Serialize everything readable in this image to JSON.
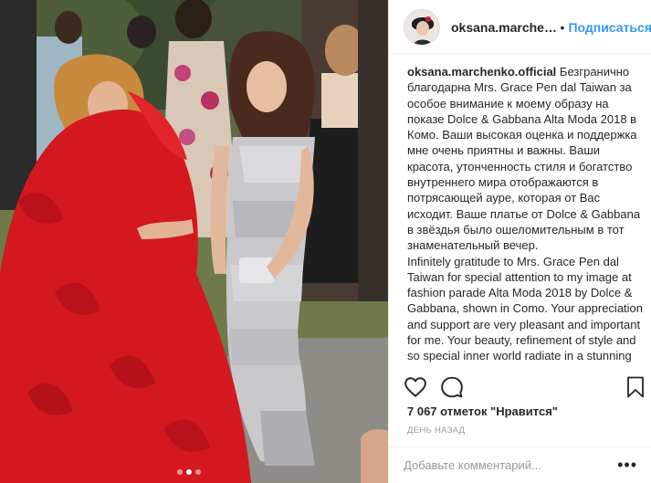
{
  "photo": {
    "alt": "",
    "carousel": {
      "count": 3,
      "active": 1
    }
  },
  "header": {
    "username": "oksana.marchenko....",
    "separator": "•",
    "follow_label": "Подписаться"
  },
  "caption": {
    "username": "oksana.marchenko.official",
    "text_ru": "Безгранично благодарна Mrs. Grace Pen dal Taiwan за особое внимание к моему образу на показе Dolce & Gabbana Alta Moda 2018 в Комо. Ваши высокая оценка и поддержка мне очень приятны и важны. Ваши красота, утонченность стиля и богатство внутреннего мира отображаются в потрясающей ауре, которая от Вас исходит. Ваше платье от Dolce & Gabbana в звёздья было ошеломительным в тот знаменательный вечер.",
    "text_en": "Infinitely gratitude to Mrs. Grace Pen dal Taiwan for special attention to my image at fashion parade Alta Moda 2018 by Dolce & Gabbana, shown in Como. Your appreciation and support are very pleasant and important for me. Your beauty, refinement of style and so special inner world radiate in a stunning aura that"
  },
  "actions": {
    "like_icon": "heart-icon",
    "comment_icon": "comment-icon",
    "save_icon": "bookmark-icon"
  },
  "likes": {
    "label": "7 067 отметок \"Нравится\""
  },
  "timestamp": {
    "label": "день назад"
  },
  "comment": {
    "placeholder": "Добавьте комментарий...",
    "more_label": "•••"
  },
  "colors": {
    "accent": "#3897f0",
    "text": "#262626",
    "muted": "#999999",
    "divider": "#efefef",
    "dress_red": "#d3181f",
    "dress_silver": "#c9c9cc"
  }
}
